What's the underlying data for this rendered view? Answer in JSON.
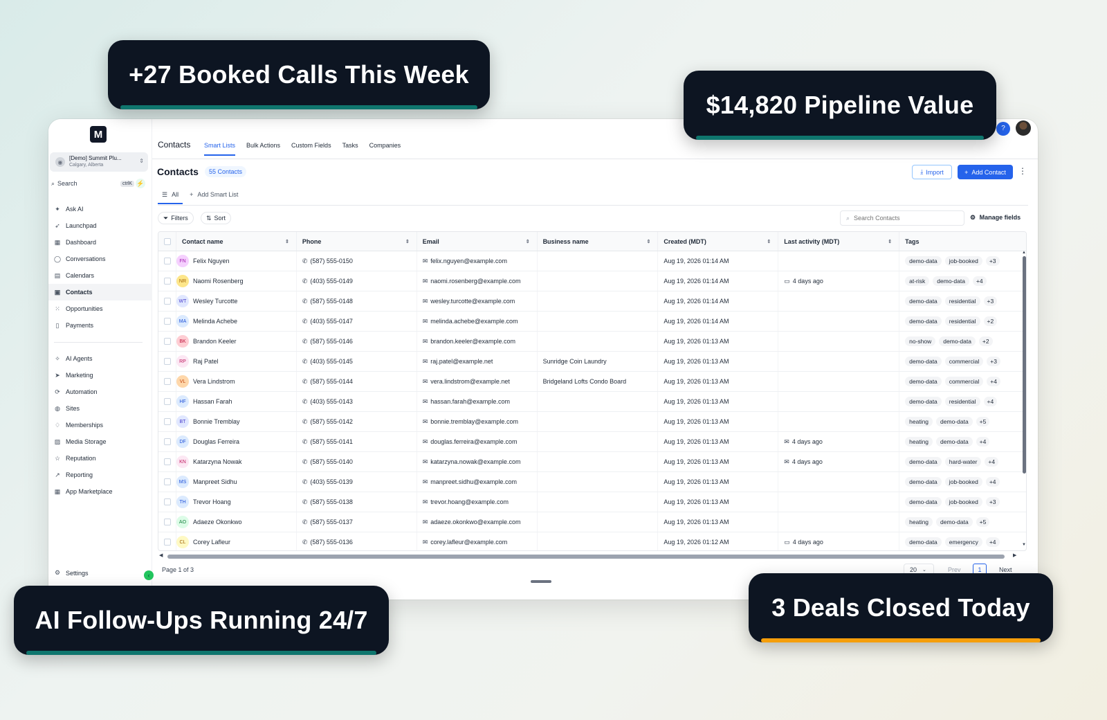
{
  "callouts": {
    "booked": "+27 Booked Calls This Week",
    "pipeline": "$14,820 Pipeline Value",
    "ai": "AI Follow-Ups Running 24/7",
    "deals": "3 Deals Closed Today"
  },
  "colors": {
    "accent": "#2563eb",
    "teal_bar": "#0f766e",
    "orange_bar": "#f59e0b",
    "callout_bg": "#0d1522"
  },
  "sidebar": {
    "logo": "M",
    "account_name": "[Demo] Summit Plu...",
    "account_location": "Calgary, Alberta",
    "search_label": "Search",
    "search_shortcut": "ctrlK",
    "nav_group1": [
      {
        "label": "Ask AI",
        "icon": "sparkle-icon"
      },
      {
        "label": "Launchpad",
        "icon": "rocket-icon"
      },
      {
        "label": "Dashboard",
        "icon": "grid-icon"
      },
      {
        "label": "Conversations",
        "icon": "chat-icon"
      },
      {
        "label": "Calendars",
        "icon": "calendar-icon"
      },
      {
        "label": "Contacts",
        "icon": "contacts-icon",
        "active": true
      },
      {
        "label": "Opportunities",
        "icon": "opportunities-icon"
      },
      {
        "label": "Payments",
        "icon": "receipt-icon"
      }
    ],
    "nav_group2": [
      {
        "label": "AI Agents",
        "icon": "ai-agents-icon"
      },
      {
        "label": "Marketing",
        "icon": "send-icon"
      },
      {
        "label": "Automation",
        "icon": "automation-icon"
      },
      {
        "label": "Sites",
        "icon": "globe-icon"
      },
      {
        "label": "Memberships",
        "icon": "membership-icon"
      },
      {
        "label": "Media Storage",
        "icon": "image-icon"
      },
      {
        "label": "Reputation",
        "icon": "star-icon"
      },
      {
        "label": "Reporting",
        "icon": "chart-icon"
      },
      {
        "label": "App Marketplace",
        "icon": "apps-icon"
      }
    ],
    "settings_label": "Settings"
  },
  "header": {
    "breadcrumb": "Contacts",
    "tabs": [
      "Smart Lists",
      "Bulk Actions",
      "Custom Fields",
      "Tasks",
      "Companies"
    ],
    "active_tab": 0,
    "help": "?"
  },
  "main": {
    "title": "Contacts",
    "count": "55 Contacts",
    "import_label": "Import",
    "add_label": "Add Contact",
    "subtab_all": "All",
    "subtab_add": "Add Smart List",
    "filters_label": "Filters",
    "sort_label": "Sort",
    "search_placeholder": "Search Contacts",
    "manage_fields": "Manage fields"
  },
  "table": {
    "headers": [
      "Contact name",
      "Phone",
      "Email",
      "Business name",
      "Created (MDT)",
      "Last activity (MDT)",
      "Tags"
    ],
    "rows": [
      {
        "initials": "FN",
        "color": "#f5d0fe",
        "fg": "#a21caf",
        "name": "Felix Nguyen",
        "phone": "(587) 555-0150",
        "email": "felix.nguyen@example.com",
        "business": "",
        "created": "Aug 19, 2026 01:14 AM",
        "last": "",
        "last_icon": "",
        "tags": [
          "demo-data",
          "job-booked"
        ],
        "more": "+3"
      },
      {
        "initials": "NR",
        "color": "#fde68a",
        "fg": "#a16207",
        "name": "Naomi Rosenberg",
        "phone": "(403) 555-0149",
        "email": "naomi.rosenberg@example.com",
        "business": "",
        "created": "Aug 19, 2026 01:14 AM",
        "last": "4 days ago",
        "last_icon": "chat",
        "tags": [
          "at-risk",
          "demo-data"
        ],
        "more": "+4"
      },
      {
        "initials": "WT",
        "color": "#e0e7ff",
        "fg": "#4338ca",
        "name": "Wesley Turcotte",
        "phone": "(587) 555-0148",
        "email": "wesley.turcotte@example.com",
        "business": "",
        "created": "Aug 19, 2026 01:14 AM",
        "last": "",
        "last_icon": "",
        "tags": [
          "demo-data",
          "residential"
        ],
        "more": "+3"
      },
      {
        "initials": "MA",
        "color": "#dbeafe",
        "fg": "#1d4ed8",
        "name": "Melinda Achebe",
        "phone": "(403) 555-0147",
        "email": "melinda.achebe@example.com",
        "business": "",
        "created": "Aug 19, 2026 01:14 AM",
        "last": "",
        "last_icon": "",
        "tags": [
          "demo-data",
          "residential"
        ],
        "more": "+2"
      },
      {
        "initials": "BK",
        "color": "#fecdd3",
        "fg": "#be123c",
        "name": "Brandon Keeler",
        "phone": "(587) 555-0146",
        "email": "brandon.keeler@example.com",
        "business": "",
        "created": "Aug 19, 2026 01:13 AM",
        "last": "",
        "last_icon": "",
        "tags": [
          "no-show",
          "demo-data"
        ],
        "more": "+2"
      },
      {
        "initials": "RP",
        "color": "#fce7f3",
        "fg": "#be185d",
        "name": "Raj Patel",
        "phone": "(403) 555-0145",
        "email": "raj.patel@example.net",
        "business": "Sunridge Coin Laundry",
        "created": "Aug 19, 2026 01:13 AM",
        "last": "",
        "last_icon": "",
        "tags": [
          "demo-data",
          "commercial"
        ],
        "more": "+3"
      },
      {
        "initials": "VL",
        "color": "#fed7aa",
        "fg": "#c2410c",
        "name": "Vera Lindstrom",
        "phone": "(587) 555-0144",
        "email": "vera.lindstrom@example.net",
        "business": "Bridgeland Lofts Condo Board",
        "created": "Aug 19, 2026 01:13 AM",
        "last": "",
        "last_icon": "",
        "tags": [
          "demo-data",
          "commercial"
        ],
        "more": "+4"
      },
      {
        "initials": "HF",
        "color": "#dbeafe",
        "fg": "#1d4ed8",
        "name": "Hassan Farah",
        "phone": "(403) 555-0143",
        "email": "hassan.farah@example.com",
        "business": "",
        "created": "Aug 19, 2026 01:13 AM",
        "last": "",
        "last_icon": "",
        "tags": [
          "demo-data",
          "residential"
        ],
        "more": "+4"
      },
      {
        "initials": "BT",
        "color": "#e0e7ff",
        "fg": "#4338ca",
        "name": "Bonnie Tremblay",
        "phone": "(587) 555-0142",
        "email": "bonnie.tremblay@example.com",
        "business": "",
        "created": "Aug 19, 2026 01:13 AM",
        "last": "",
        "last_icon": "",
        "tags": [
          "heating",
          "demo-data"
        ],
        "more": "+5"
      },
      {
        "initials": "DF",
        "color": "#dbeafe",
        "fg": "#1d4ed8",
        "name": "Douglas Ferreira",
        "phone": "(587) 555-0141",
        "email": "douglas.ferreira@example.com",
        "business": "",
        "created": "Aug 19, 2026 01:13 AM",
        "last": "4 days ago",
        "last_icon": "mail",
        "tags": [
          "heating",
          "demo-data"
        ],
        "more": "+4"
      },
      {
        "initials": "KN",
        "color": "#fce7f3",
        "fg": "#be185d",
        "name": "Katarzyna Nowak",
        "phone": "(587) 555-0140",
        "email": "katarzyna.nowak@example.com",
        "business": "",
        "created": "Aug 19, 2026 01:13 AM",
        "last": "4 days ago",
        "last_icon": "mail",
        "tags": [
          "demo-data",
          "hard-water"
        ],
        "more": "+4"
      },
      {
        "initials": "MS",
        "color": "#dbeafe",
        "fg": "#1d4ed8",
        "name": "Manpreet Sidhu",
        "phone": "(403) 555-0139",
        "email": "manpreet.sidhu@example.com",
        "business": "",
        "created": "Aug 19, 2026 01:13 AM",
        "last": "",
        "last_icon": "",
        "tags": [
          "demo-data",
          "job-booked"
        ],
        "more": "+4"
      },
      {
        "initials": "TH",
        "color": "#dbeafe",
        "fg": "#1d4ed8",
        "name": "Trevor Hoang",
        "phone": "(587) 555-0138",
        "email": "trevor.hoang@example.com",
        "business": "",
        "created": "Aug 19, 2026 01:13 AM",
        "last": "",
        "last_icon": "",
        "tags": [
          "demo-data",
          "job-booked"
        ],
        "more": "+3"
      },
      {
        "initials": "AO",
        "color": "#dcfce7",
        "fg": "#15803d",
        "name": "Adaeze Okonkwo",
        "phone": "(587) 555-0137",
        "email": "adaeze.okonkwo@example.com",
        "business": "",
        "created": "Aug 19, 2026 01:13 AM",
        "last": "",
        "last_icon": "",
        "tags": [
          "heating",
          "demo-data"
        ],
        "more": "+5"
      },
      {
        "initials": "CL",
        "color": "#fef9c3",
        "fg": "#a16207",
        "name": "Corey Lafleur",
        "phone": "(587) 555-0136",
        "email": "corey.lafleur@example.com",
        "business": "",
        "created": "Aug 19, 2026 01:12 AM",
        "last": "4 days ago",
        "last_icon": "chat",
        "tags": [
          "demo-data",
          "emergency"
        ],
        "more": "+4"
      }
    ]
  },
  "pagination": {
    "page_info": "Page 1 of 3",
    "page_size": "20",
    "prev": "Prev",
    "current": "1",
    "next": "Next"
  }
}
